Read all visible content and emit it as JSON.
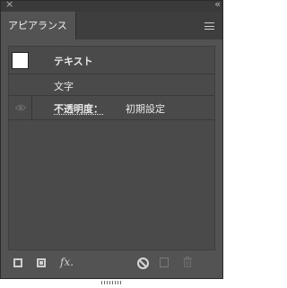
{
  "panel": {
    "close_glyph": "×",
    "collapse_glyph": "‹‹",
    "tab_label": "アピアランス",
    "menu_icon": "hamburger-menu-icon"
  },
  "rows": [
    {
      "label": "テキスト",
      "swatch_color": "#ffffff"
    },
    {
      "label": "文字"
    },
    {
      "label": "不透明度：",
      "value": "初期設定",
      "icon": "eye-icon"
    }
  ],
  "footer": {
    "icons": [
      "add-stroke-icon",
      "add-fill-icon",
      "fx-icon",
      "clear-appearance-icon",
      "duplicate-item-icon",
      "delete-item-icon"
    ],
    "fx_glyph": "fx."
  },
  "colors": {
    "panel_bg": "#535353",
    "list_bg": "#4a4a4a",
    "tabbar_bg": "#3e3e3e",
    "text": "#e8e8e8"
  }
}
